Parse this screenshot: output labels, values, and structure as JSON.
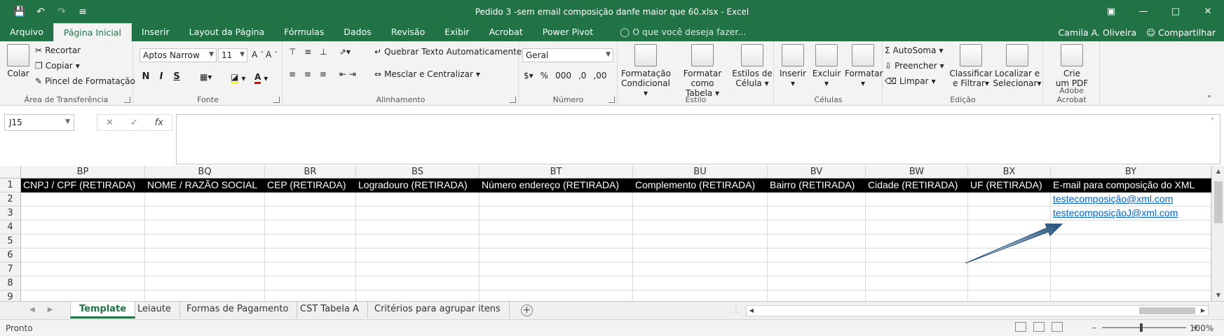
{
  "window": {
    "title": "Pedido 3 -sem email composição danfe maior que 60.xlsx - Excel",
    "controls": [
      "restore-ribbon-icon",
      "minimize-icon",
      "maximize-icon",
      "close-icon"
    ]
  },
  "menu": {
    "tabs": [
      "Arquivo",
      "Página Inicial",
      "Inserir",
      "Layout da Página",
      "Fórmulas",
      "Dados",
      "Revisão",
      "Exibir",
      "Acrobat",
      "Power Pivot"
    ],
    "active_tab": "Página Inicial",
    "tell_me": "O que você deseja fazer...",
    "user": "Camila A. Oliveira",
    "share": "Compartilhar"
  },
  "ribbon": {
    "clipboard": {
      "label": "Área de Transferência",
      "paste": "Colar",
      "cut": "Recortar",
      "copy": "Copiar",
      "format_painter": "Pincel de Formatação"
    },
    "font": {
      "label": "Fonte",
      "name": "Aptos Narrow",
      "size": "11"
    },
    "alignment": {
      "label": "Alinhamento",
      "wrap": "Quebrar Texto Automaticamente",
      "merge": "Mesclar e Centralizar"
    },
    "number": {
      "label": "Número",
      "format": "Geral"
    },
    "styles": {
      "label": "Estilo",
      "conditional_l1": "Formatação",
      "conditional_l2": "Condicional",
      "table_l1": "Formatar como",
      "table_l2": "Tabela",
      "cell_l1": "Estilos de",
      "cell_l2": "Célula"
    },
    "cells": {
      "label": "Células",
      "insert": "Inserir",
      "delete": "Excluir",
      "format": "Formatar"
    },
    "editing": {
      "label": "Edição",
      "autosum": "AutoSoma",
      "fill": "Preencher",
      "clear": "Limpar",
      "sort_l1": "Classificar",
      "sort_l2": "e Filtrar",
      "find_l1": "Localizar e",
      "find_l2": "Selecionar"
    },
    "acrobat": {
      "label": "Adobe Acrobat",
      "create_l1": "Crie",
      "create_l2": "um PDF"
    }
  },
  "formula_bar": {
    "name_box": "J15",
    "fx": "fx",
    "formula": ""
  },
  "grid": {
    "columns": [
      "BP",
      "BQ",
      "BR",
      "BS",
      "BT",
      "BU",
      "BV",
      "BW",
      "BX",
      "BY"
    ],
    "rows": [
      "1",
      "2",
      "3",
      "4",
      "5",
      "6",
      "7",
      "8",
      "9"
    ],
    "header_row": [
      "CNPJ / CPF (RETIRADA)",
      "NOME / RAZÃO SOCIAL",
      "CEP  (RETIRADA)",
      "Logradouro  (RETIRADA)",
      "Número endereço  (RETIRADA)",
      "Complemento  (RETIRADA)",
      "Bairro  (RETIRADA)",
      "Cidade  (RETIRADA)",
      "UF  (RETIRADA)",
      "E-mail para composição do XML"
    ],
    "by_values": [
      "testecomposição@xml.com",
      "testecomposiçãoJ@xml.com"
    ],
    "annotation_color": "#1f4e79"
  },
  "sheets": {
    "tabs": [
      "Template",
      "Leiaute",
      "Formas de Pagamento",
      "CST Tabela A",
      "Critérios para agrupar itens"
    ],
    "active": "Template"
  },
  "status": {
    "text": "Pronto",
    "zoom": "100%"
  }
}
